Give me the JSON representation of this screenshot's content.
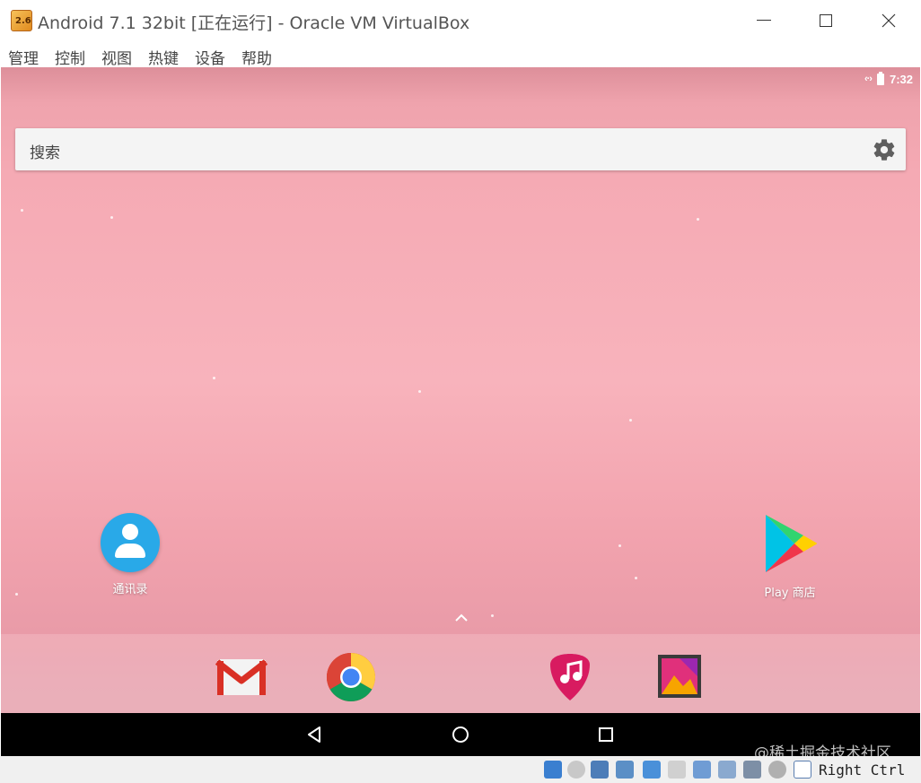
{
  "window": {
    "title": "Android 7.1 32bit [正在运行] - Oracle VM VirtualBox",
    "icon_text": "2.6"
  },
  "menu": [
    "管理",
    "控制",
    "视图",
    "热键",
    "设备",
    "帮助"
  ],
  "android": {
    "status_time": "7:32",
    "status_net": "‹·›",
    "search_label": "搜索",
    "apps": {
      "contacts_label": "通讯录",
      "play_label": "Play 商店"
    },
    "dock": [
      "gmail-icon",
      "chrome-icon",
      "music-icon",
      "gallery-icon"
    ],
    "nav": [
      "back-icon",
      "home-icon",
      "recents-icon"
    ]
  },
  "statusbar": {
    "host_key": "Right Ctrl"
  },
  "watermark": "@稀土掘金技术社区",
  "colors": {
    "wallpaper": "#f5aab4",
    "contacts": "#29a9e8",
    "navbar": "#000000"
  }
}
